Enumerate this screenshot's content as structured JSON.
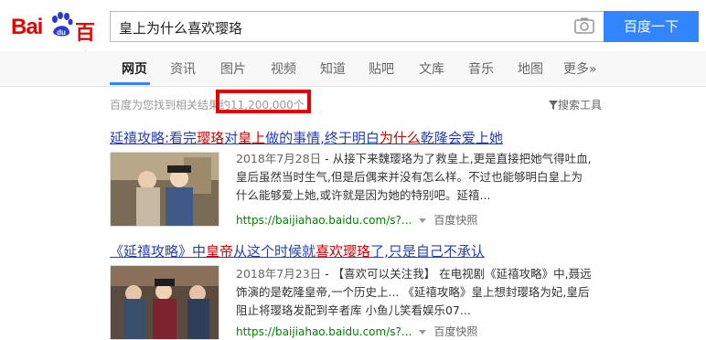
{
  "logo": {
    "bai": "Bai",
    "du": "du",
    "baidu_cn": "百度"
  },
  "search": {
    "query": "皇上为什么喜欢璎珞",
    "button": "百度一下"
  },
  "nav": {
    "tabs": [
      "网页",
      "资讯",
      "图片",
      "视频",
      "知道",
      "贴吧",
      "文库",
      "音乐",
      "地图",
      "更多»"
    ]
  },
  "results_info": {
    "prefix": "百度为您找到相关结果约",
    "count": "11,200,000个",
    "tools": "搜索工具"
  },
  "results": [
    {
      "title_parts": [
        "延禧攻略:看完",
        "璎珞",
        "对",
        "皇上",
        "做的事情,终于明白",
        "为什么",
        "乾隆会爱上她"
      ],
      "date": "2018年7月28日",
      "abstract_line1": " - 从接下来魏璎珞为了救皇上,更是直接把她气得吐血,",
      "abstract_line2": "皇后虽然当时生气,但是后偶来并没有怎么样。不过也能够明白皇上为",
      "abstract_line3": "什么能够爱上她,或许就是因为她的特别吧。延禧...",
      "url": "https://baijiahao.baidu.com/s?...",
      "snapshot": "百度快照"
    },
    {
      "title_parts": [
        "《延禧攻略》中",
        "皇帝",
        "从这个时候就",
        "喜欢璎珞",
        "了,只是自己不承认"
      ],
      "date": "2018年7月23日",
      "abstract_line1": " - 【喜欢可以关注我】 在电视剧《延禧攻略》中,聂远",
      "abstract_line2": "饰演的是乾隆皇帝,一个历史上... 《延禧攻略》皇上想封璎珞为妃,皇后",
      "abstract_line3": "阻止将璎珞发配到辛者库 小鱼儿笑看娱乐07...",
      "url": "https://baijiahao.baidu.com/s?...",
      "snapshot": "百度快照"
    }
  ],
  "icons": {
    "camera": "camera-icon",
    "paw": "baidu-paw-icon",
    "filter": "filter-icon",
    "dropdown": "dropdown-arrow-icon"
  }
}
